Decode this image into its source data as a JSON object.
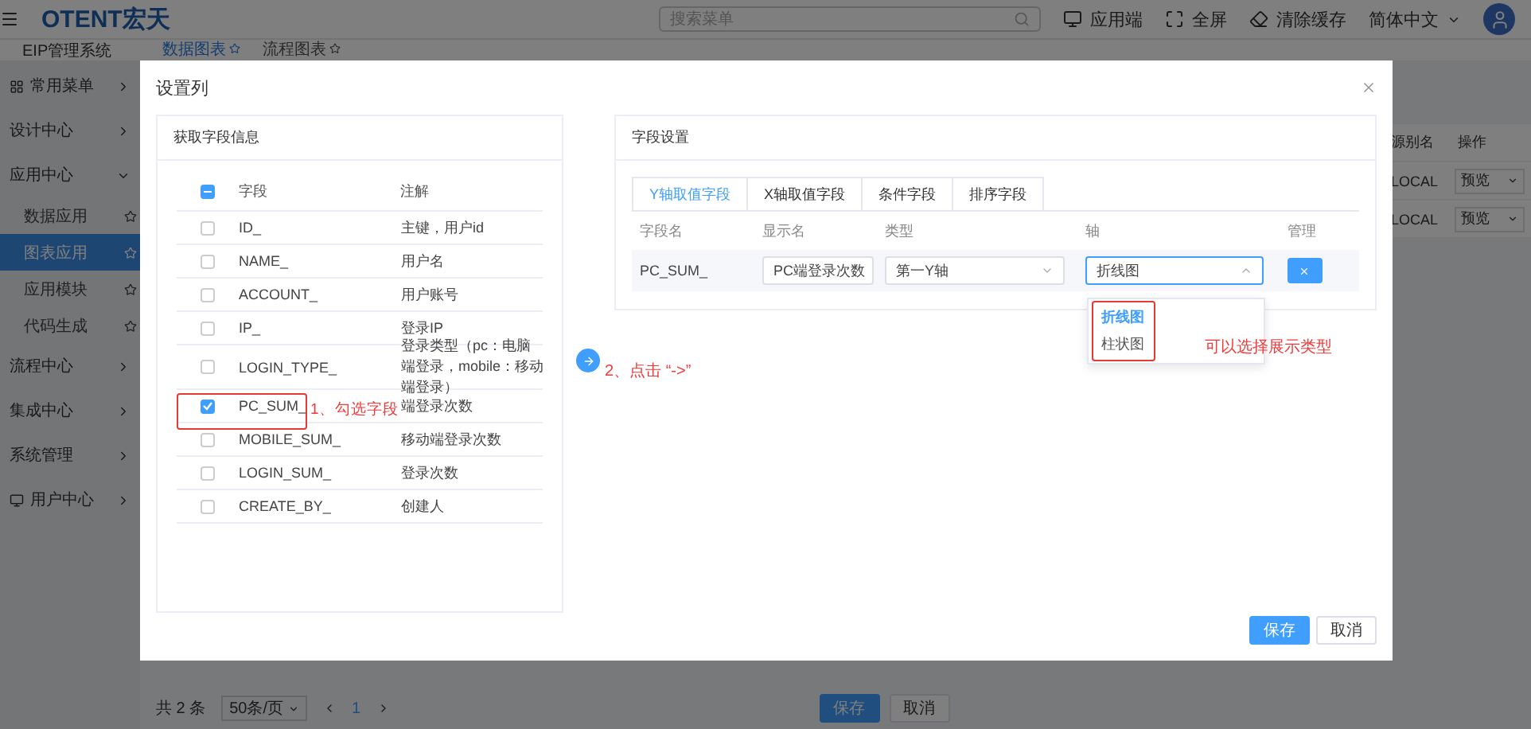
{
  "header": {
    "logo": "OTENT宏天",
    "search_placeholder": "搜索菜单",
    "actions": [
      {
        "label": "应用端",
        "kind": "monitor"
      },
      {
        "label": "全屏",
        "kind": "fullscreen"
      },
      {
        "label": "清除缓存",
        "kind": "clear"
      }
    ],
    "language": "简体中文"
  },
  "system_name": "EIP管理系统",
  "page_tabs": [
    {
      "label": "数据图表",
      "selected": true
    },
    {
      "label": "流程图表",
      "selected": false
    }
  ],
  "sidebar": {
    "items": [
      {
        "label": "常用菜单",
        "expanded": false,
        "kind": "grid"
      },
      {
        "label": "设计中心",
        "expanded": false
      },
      {
        "label": "应用中心",
        "expanded": true,
        "children": [
          {
            "label": "数据应用",
            "selected": false
          },
          {
            "label": "图表应用",
            "selected": true
          },
          {
            "label": "应用模块",
            "selected": false
          },
          {
            "label": "代码生成",
            "selected": false
          }
        ]
      },
      {
        "label": "流程中心",
        "expanded": false
      },
      {
        "label": "集成中心",
        "expanded": false
      },
      {
        "label": "系统管理",
        "expanded": false
      },
      {
        "label": "用户中心",
        "expanded": false,
        "kind": "monitor"
      }
    ]
  },
  "background_table": {
    "columns": [
      "源别名",
      "操作"
    ],
    "rows": [
      {
        "source": "LOCAL",
        "action": "预览"
      },
      {
        "source": "LOCAL",
        "action": "预览"
      }
    ]
  },
  "background_footer": {
    "total": "共 2 条",
    "page_size": "50条/页",
    "page": "1",
    "buttons": [
      {
        "label": "保存",
        "kind": "primary"
      },
      {
        "label": "取消",
        "kind": "default"
      }
    ]
  },
  "dialog": {
    "title": "设置列",
    "left_panel": {
      "title": "获取字段信息",
      "columns": [
        "字段",
        "注解"
      ],
      "all_indeterminate": true,
      "rows": [
        {
          "field": "ID_",
          "note": "主键，用户id",
          "checked": false
        },
        {
          "field": "NAME_",
          "note": "用户名",
          "checked": false
        },
        {
          "field": "ACCOUNT_",
          "note": "用户账号",
          "checked": false
        },
        {
          "field": "IP_",
          "note": "登录IP",
          "checked": false
        },
        {
          "field": "LOGIN_TYPE_",
          "note": "登录类型（pc：电脑端登录，mobile：移动端登录）",
          "checked": false
        },
        {
          "field": "PC_SUM_",
          "note": "端登录次数",
          "checked": true
        },
        {
          "field": "MOBILE_SUM_",
          "note": "移动端登录次数",
          "checked": false
        },
        {
          "field": "LOGIN_SUM_",
          "note": "登录次数",
          "checked": false
        },
        {
          "field": "CREATE_BY_",
          "note": "创建人",
          "checked": false
        }
      ]
    },
    "right_panel": {
      "title": "字段设置",
      "tabs": [
        {
          "label": "Y轴取值字段",
          "selected": true
        },
        {
          "label": "X轴取值字段",
          "selected": false
        },
        {
          "label": "条件字段",
          "selected": false
        },
        {
          "label": "排序字段",
          "selected": false
        }
      ],
      "columns": [
        "字段名",
        "显示名",
        "类型",
        "轴",
        "管理"
      ],
      "rows": [
        {
          "field": "PC_SUM_",
          "display_name": "PC端登录次数",
          "type": "第一Y轴",
          "axis": "折线图",
          "axis_open": true
        }
      ]
    },
    "axis_options": [
      {
        "label": "折线图",
        "selected": true
      },
      {
        "label": "柱状图",
        "selected": false
      }
    ],
    "annotation_check": "1、勾选字段",
    "annotation_click": "2、点击 “->”",
    "annotation_type": "可以选择展示类型",
    "buttons": [
      {
        "label": "保存",
        "kind": "primary"
      },
      {
        "label": "取消",
        "kind": "default"
      }
    ]
  }
}
